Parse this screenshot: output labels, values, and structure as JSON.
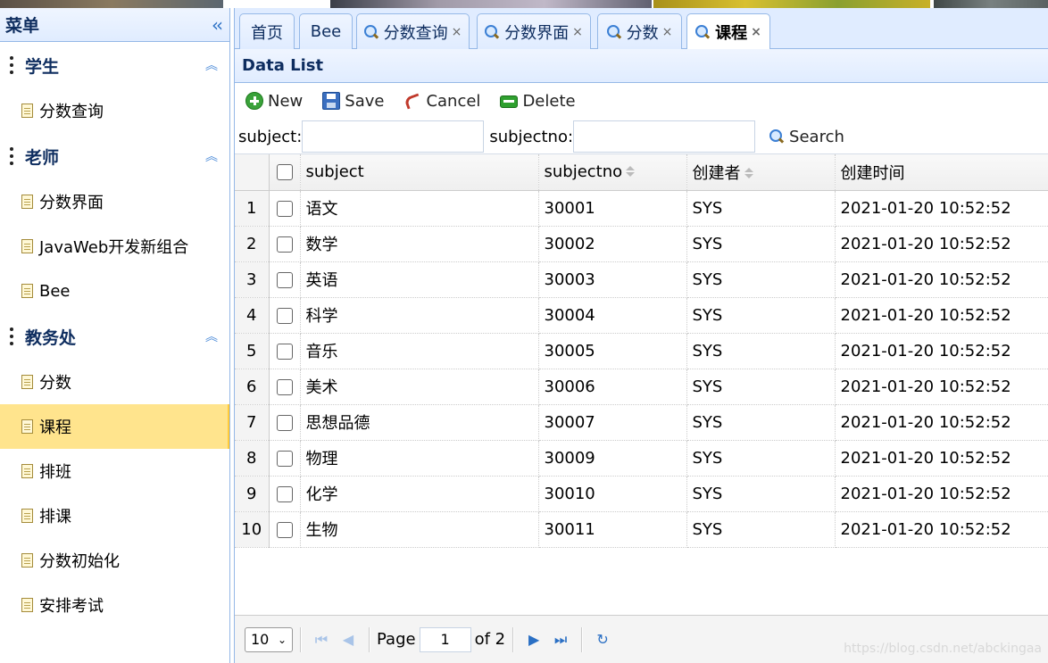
{
  "sidebar": {
    "title": "菜单",
    "collapse_icon": "double-chevron-left-icon",
    "groups": [
      {
        "label": "学生",
        "items": [
          "分数查询"
        ]
      },
      {
        "label": "老师",
        "items": [
          "分数界面",
          "JavaWeb开发新组合",
          "Bee"
        ]
      },
      {
        "label": "教务处",
        "items": [
          "分数",
          "课程",
          "排班",
          "排课",
          "分数初始化",
          "安排考试"
        ]
      }
    ],
    "active_item": "课程"
  },
  "tabs": [
    {
      "label": "首页",
      "closable": false,
      "icon": ""
    },
    {
      "label": "Bee",
      "closable": false,
      "icon": ""
    },
    {
      "label": "分数查询",
      "closable": true,
      "icon": "search-icon"
    },
    {
      "label": "分数界面",
      "closable": true,
      "icon": "search-icon"
    },
    {
      "label": "分数",
      "closable": true,
      "icon": "search-icon"
    },
    {
      "label": "课程",
      "closable": true,
      "icon": "search-icon",
      "selected": true
    }
  ],
  "tab_close": "×",
  "panel": {
    "title": "Data List"
  },
  "toolbar": {
    "new_label": "New",
    "save_label": "Save",
    "cancel_label": "Cancel",
    "delete_label": "Delete"
  },
  "search": {
    "subject_label": "subject:",
    "subject_value": "",
    "subjectno_label": "subjectno:",
    "subjectno_value": "",
    "search_label": "Search"
  },
  "grid": {
    "columns": [
      "subject",
      "subjectno",
      "创建者",
      "创建时间"
    ],
    "rows": [
      {
        "n": "1",
        "subject": "语文",
        "subjectno": "30001",
        "creator": "SYS",
        "time": "2021-01-20 10:52:52"
      },
      {
        "n": "2",
        "subject": "数学",
        "subjectno": "30002",
        "creator": "SYS",
        "time": "2021-01-20 10:52:52"
      },
      {
        "n": "3",
        "subject": "英语",
        "subjectno": "30003",
        "creator": "SYS",
        "time": "2021-01-20 10:52:52"
      },
      {
        "n": "4",
        "subject": "科学",
        "subjectno": "30004",
        "creator": "SYS",
        "time": "2021-01-20 10:52:52"
      },
      {
        "n": "5",
        "subject": "音乐",
        "subjectno": "30005",
        "creator": "SYS",
        "time": "2021-01-20 10:52:52"
      },
      {
        "n": "6",
        "subject": "美术",
        "subjectno": "30006",
        "creator": "SYS",
        "time": "2021-01-20 10:52:52"
      },
      {
        "n": "7",
        "subject": "思想品德",
        "subjectno": "30007",
        "creator": "SYS",
        "time": "2021-01-20 10:52:52"
      },
      {
        "n": "8",
        "subject": "物理",
        "subjectno": "30009",
        "creator": "SYS",
        "time": "2021-01-20 10:52:52"
      },
      {
        "n": "9",
        "subject": "化学",
        "subjectno": "30010",
        "creator": "SYS",
        "time": "2021-01-20 10:52:52"
      },
      {
        "n": "10",
        "subject": "生物",
        "subjectno": "30011",
        "creator": "SYS",
        "time": "2021-01-20 10:52:52"
      }
    ]
  },
  "pager": {
    "page_size": "10",
    "page_label": "Page",
    "page_value": "1",
    "of_label": "of 2"
  },
  "watermark": "https://blog.csdn.net/abckingaa"
}
